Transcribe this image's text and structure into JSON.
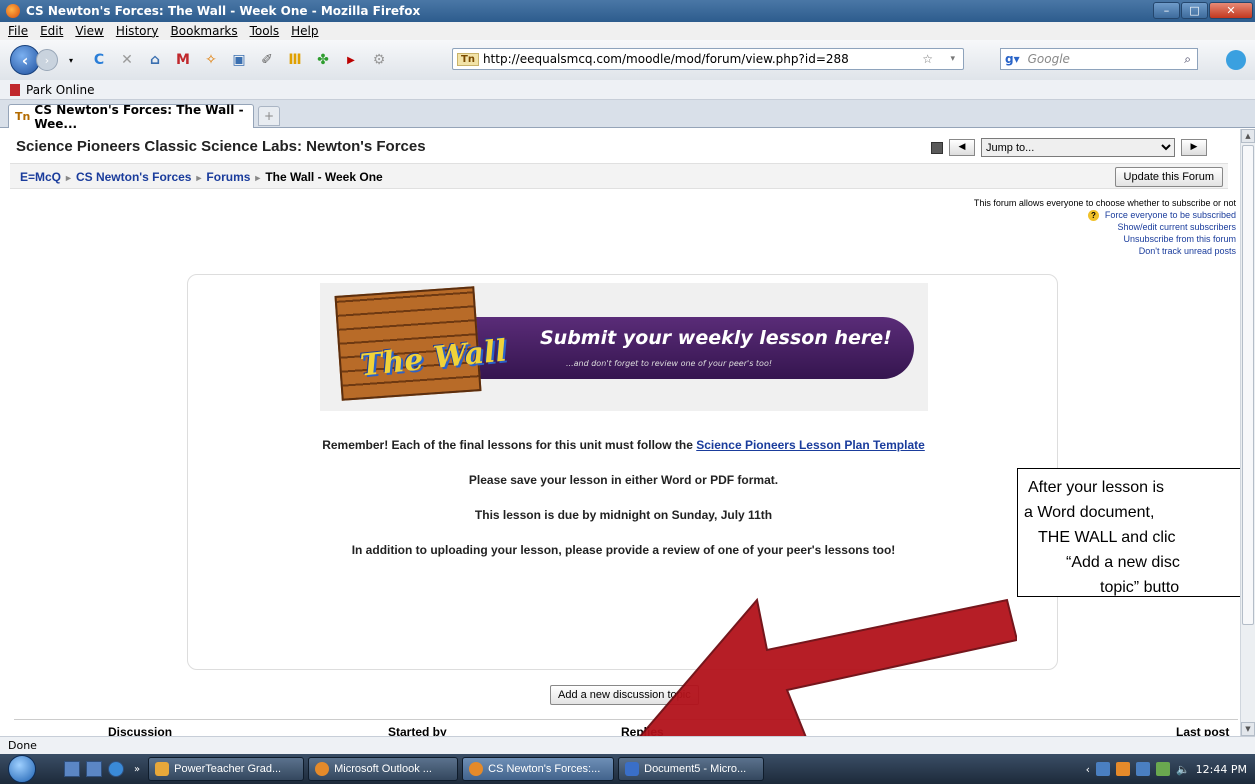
{
  "window": {
    "title": "CS Newton's Forces: The Wall - Week One - Mozilla Firefox"
  },
  "menu": [
    "File",
    "Edit",
    "View",
    "History",
    "Bookmarks",
    "Tools",
    "Help"
  ],
  "browser": {
    "url": "http://eequalsmcq.com/moodle/mod/forum/view.php?id=288",
    "site_badge": "Tn",
    "search_placeholder": "Google",
    "bookmark": "Park Online",
    "tab_title": "CS Newton's Forces: The Wall - Wee...",
    "new_tab": "+",
    "status": "Done"
  },
  "course": {
    "title": "Science Pioneers Classic Science Labs: Newton's Forces",
    "jump_to": "Jump to...",
    "breadcrumbs": [
      "E=McQ",
      "CS Newton's Forces",
      "Forums",
      "The Wall - Week One"
    ],
    "update_button": "Update this Forum"
  },
  "subscription": {
    "info": "This forum allows everyone to choose whether to subscribe or not",
    "force": "Force everyone to be subscribed",
    "show_edit": "Show/edit current subscribers",
    "unsubscribe": "Unsubscribe from this forum",
    "dont_track": "Don't track unread posts"
  },
  "banner": {
    "wall": "The Wall",
    "headline": "Submit your weekly lesson here!",
    "subline": "...and don't forget to review one of your peer's too!"
  },
  "intro": {
    "line1_prefix": "Remember! Each of the final lessons for this unit must follow the",
    "line1_link": "Science Pioneers Lesson Plan Template",
    "line2": "Please save your lesson in either Word or PDF format.",
    "line3": "This lesson is due by midnight on Sunday, July 11th",
    "line4": "In addition to uploading your lesson, please provide a review of one of your peer's lessons too!"
  },
  "add_topic_button": "Add a new discussion topic",
  "table_headers": {
    "discussion": "Discussion",
    "started_by": "Started by",
    "replies": "Replies",
    "last_post": "Last post"
  },
  "callout": [
    "After your lesson is",
    "a Word document,",
    "THE WALL and clic",
    "“Add a new disc",
    "topic” butto"
  ],
  "taskbar": {
    "items": [
      "PowerTeacher Grad...",
      "Microsoft Outlook ...",
      "CS Newton's Forces:...",
      "Document5 - Micro..."
    ],
    "clock": "12:44 PM",
    "chevron": "»"
  },
  "colors": {
    "link": "#1a3c9c",
    "arrow": "#b3121b",
    "banner_bar": "#4a2366"
  }
}
